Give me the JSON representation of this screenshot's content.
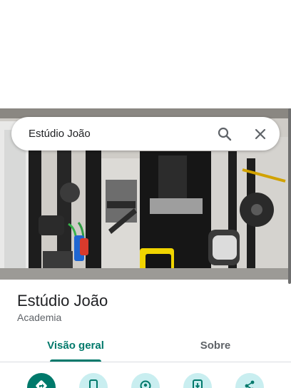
{
  "search": {
    "query": "Estúdio João",
    "search_icon": "search-icon",
    "close_icon": "close-icon"
  },
  "place": {
    "name": "Estúdio João",
    "category": "Academia"
  },
  "tabs": [
    {
      "label": "Visão geral",
      "selected": true
    },
    {
      "label": "Sobre",
      "selected": false
    }
  ],
  "actions": [
    {
      "icon": "directions-icon"
    },
    {
      "icon": "phone-icon"
    },
    {
      "icon": "location-icon"
    },
    {
      "icon": "save-to-phone-icon"
    },
    {
      "icon": "share-icon"
    }
  ],
  "colors": {
    "accent": "#00796b",
    "action_secondary_bg": "#c9eef0",
    "text_primary": "#202124",
    "text_secondary": "#5f6368"
  }
}
